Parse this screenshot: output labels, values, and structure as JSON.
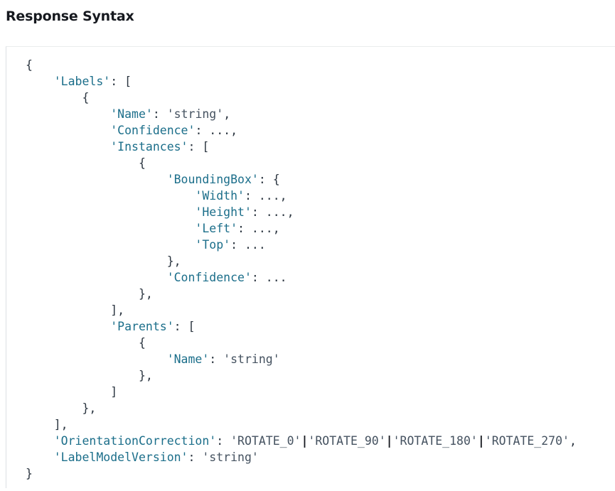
{
  "heading": "Response Syntax",
  "code_lines": [
    [
      {
        "t": "{",
        "k": "pun"
      }
    ],
    [
      {
        "t": "    ",
        "k": "ind"
      },
      {
        "t": "'Labels'",
        "k": "key"
      },
      {
        "t": ": [",
        "k": "pun"
      }
    ],
    [
      {
        "t": "        ",
        "k": "ind"
      },
      {
        "t": "{",
        "k": "pun"
      }
    ],
    [
      {
        "t": "            ",
        "k": "ind"
      },
      {
        "t": "'Name'",
        "k": "key"
      },
      {
        "t": ": ",
        "k": "pun"
      },
      {
        "t": "'string'",
        "k": "str"
      },
      {
        "t": ",",
        "k": "pun"
      }
    ],
    [
      {
        "t": "            ",
        "k": "ind"
      },
      {
        "t": "'Confidence'",
        "k": "key"
      },
      {
        "t": ": ...,",
        "k": "pun"
      }
    ],
    [
      {
        "t": "            ",
        "k": "ind"
      },
      {
        "t": "'Instances'",
        "k": "key"
      },
      {
        "t": ": [",
        "k": "pun"
      }
    ],
    [
      {
        "t": "                ",
        "k": "ind"
      },
      {
        "t": "{",
        "k": "pun"
      }
    ],
    [
      {
        "t": "                    ",
        "k": "ind"
      },
      {
        "t": "'BoundingBox'",
        "k": "key"
      },
      {
        "t": ": {",
        "k": "pun"
      }
    ],
    [
      {
        "t": "                        ",
        "k": "ind"
      },
      {
        "t": "'Width'",
        "k": "key"
      },
      {
        "t": ": ...,",
        "k": "pun"
      }
    ],
    [
      {
        "t": "                        ",
        "k": "ind"
      },
      {
        "t": "'Height'",
        "k": "key"
      },
      {
        "t": ": ...,",
        "k": "pun"
      }
    ],
    [
      {
        "t": "                        ",
        "k": "ind"
      },
      {
        "t": "'Left'",
        "k": "key"
      },
      {
        "t": ": ...,",
        "k": "pun"
      }
    ],
    [
      {
        "t": "                        ",
        "k": "ind"
      },
      {
        "t": "'Top'",
        "k": "key"
      },
      {
        "t": ": ...",
        "k": "pun"
      }
    ],
    [
      {
        "t": "                    ",
        "k": "ind"
      },
      {
        "t": "},",
        "k": "pun"
      }
    ],
    [
      {
        "t": "                    ",
        "k": "ind"
      },
      {
        "t": "'Confidence'",
        "k": "key"
      },
      {
        "t": ": ...",
        "k": "pun"
      }
    ],
    [
      {
        "t": "                ",
        "k": "ind"
      },
      {
        "t": "},",
        "k": "pun"
      }
    ],
    [
      {
        "t": "            ",
        "k": "ind"
      },
      {
        "t": "],",
        "k": "pun"
      }
    ],
    [
      {
        "t": "            ",
        "k": "ind"
      },
      {
        "t": "'Parents'",
        "k": "key"
      },
      {
        "t": ": [",
        "k": "pun"
      }
    ],
    [
      {
        "t": "                ",
        "k": "ind"
      },
      {
        "t": "{",
        "k": "pun"
      }
    ],
    [
      {
        "t": "                    ",
        "k": "ind"
      },
      {
        "t": "'Name'",
        "k": "key"
      },
      {
        "t": ": ",
        "k": "pun"
      },
      {
        "t": "'string'",
        "k": "str"
      }
    ],
    [
      {
        "t": "                ",
        "k": "ind"
      },
      {
        "t": "},",
        "k": "pun"
      }
    ],
    [
      {
        "t": "            ",
        "k": "ind"
      },
      {
        "t": "]",
        "k": "pun"
      }
    ],
    [
      {
        "t": "        ",
        "k": "ind"
      },
      {
        "t": "},",
        "k": "pun"
      }
    ],
    [
      {
        "t": "    ",
        "k": "ind"
      },
      {
        "t": "],",
        "k": "pun"
      }
    ],
    [
      {
        "t": "    ",
        "k": "ind"
      },
      {
        "t": "'OrientationCorrection'",
        "k": "key"
      },
      {
        "t": ": ",
        "k": "pun"
      },
      {
        "t": "'ROTATE_0'",
        "k": "str"
      },
      {
        "t": "|",
        "k": "sep"
      },
      {
        "t": "'ROTATE_90'",
        "k": "str"
      },
      {
        "t": "|",
        "k": "sep"
      },
      {
        "t": "'ROTATE_180'",
        "k": "str"
      },
      {
        "t": "|",
        "k": "sep"
      },
      {
        "t": "'ROTATE_270'",
        "k": "str"
      },
      {
        "t": ",",
        "k": "pun"
      }
    ],
    [
      {
        "t": "    ",
        "k": "ind"
      },
      {
        "t": "'LabelModelVersion'",
        "k": "key"
      },
      {
        "t": ": ",
        "k": "pun"
      },
      {
        "t": "'string'",
        "k": "str"
      }
    ],
    [
      {
        "t": "}",
        "k": "pun"
      }
    ]
  ],
  "colors": {
    "key": "#1b6e8a",
    "string": "#455260",
    "punctuation": "#2b3540",
    "heading": "#16191f",
    "code_border": "#dcdfe3"
  }
}
